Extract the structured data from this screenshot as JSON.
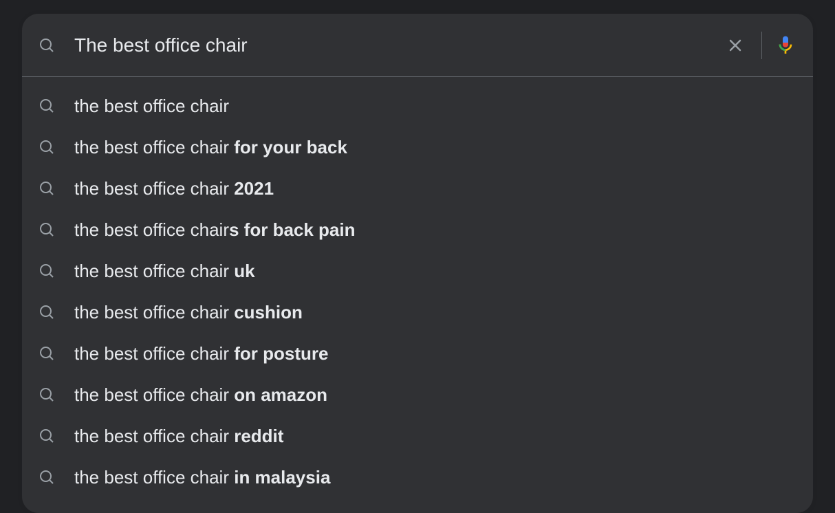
{
  "search": {
    "query": "The best office chair",
    "placeholder": ""
  },
  "suggestions": [
    {
      "prefix": "the best office chair",
      "suffix": ""
    },
    {
      "prefix": "the best office chair ",
      "suffix": "for your back"
    },
    {
      "prefix": "the best office chair ",
      "suffix": "2021"
    },
    {
      "prefix": "the best office chair",
      "suffix": "s for back pain"
    },
    {
      "prefix": "the best office chair ",
      "suffix": "uk"
    },
    {
      "prefix": "the best office chair ",
      "suffix": "cushion"
    },
    {
      "prefix": "the best office chair ",
      "suffix": "for posture"
    },
    {
      "prefix": "the best office chair ",
      "suffix": "on amazon"
    },
    {
      "prefix": "the best office chair ",
      "suffix": "reddit"
    },
    {
      "prefix": "the best office chair ",
      "suffix": "in malaysia"
    }
  ]
}
